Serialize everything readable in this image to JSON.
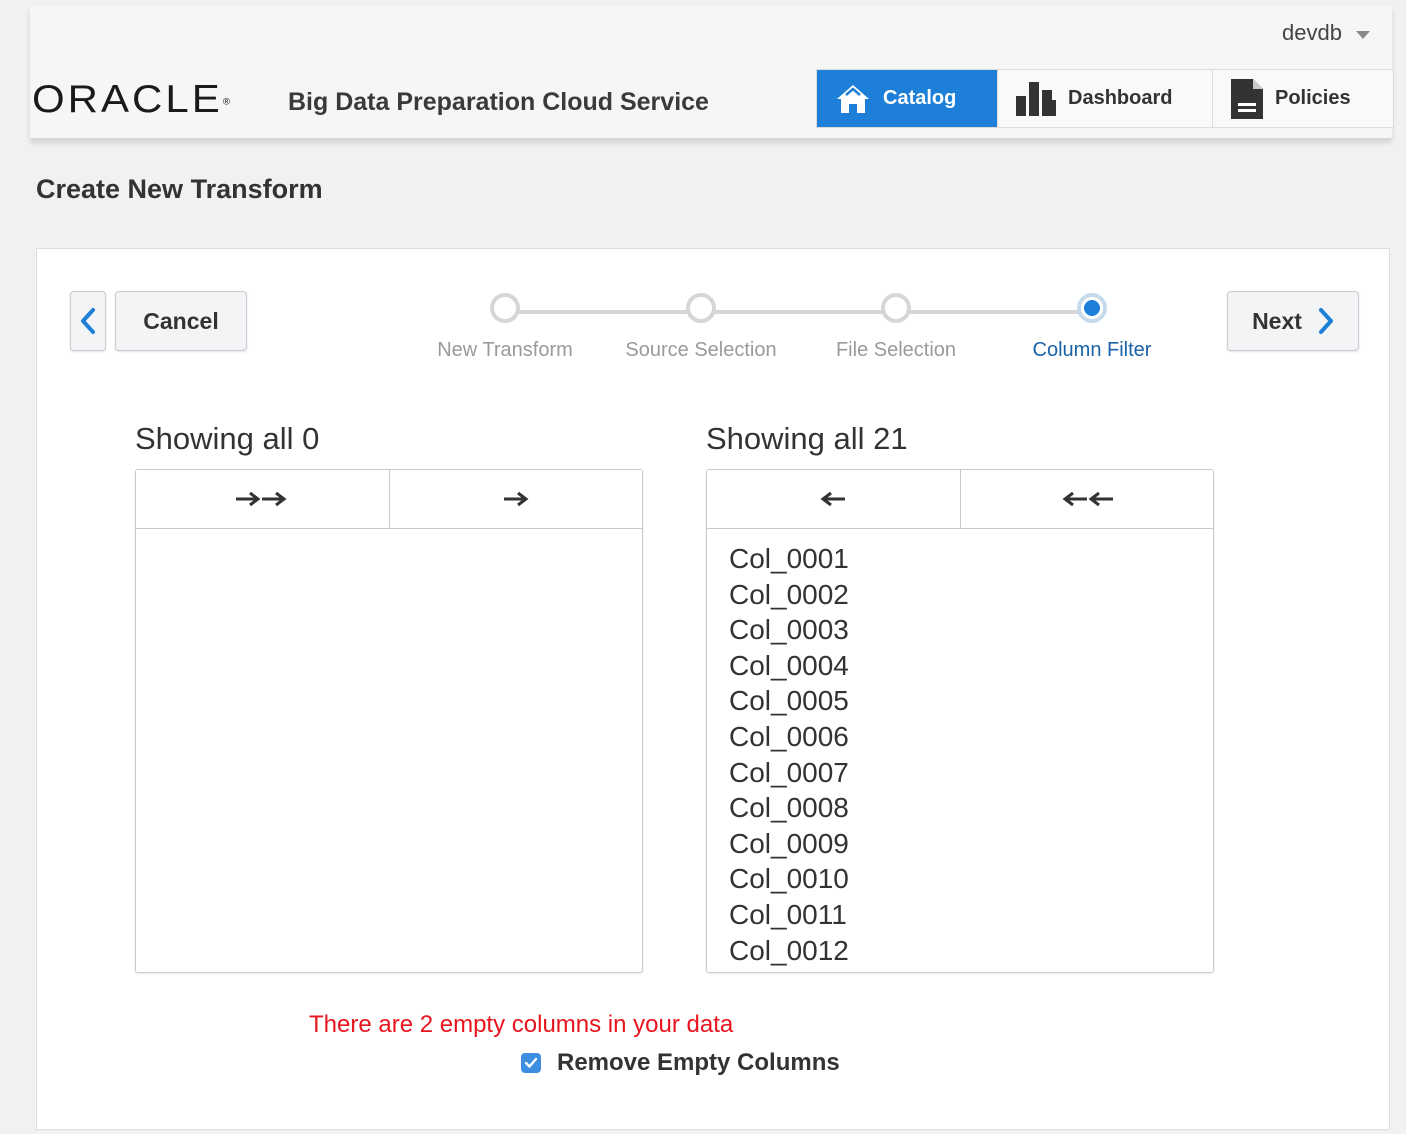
{
  "header": {
    "user": "devdb",
    "logo_text": "ORACLE",
    "service_name": "Big Data Preparation Cloud Service",
    "nav_tabs": [
      {
        "label": "Catalog",
        "icon": "home-icon",
        "active": true
      },
      {
        "label": "Dashboard",
        "icon": "bar-chart-icon",
        "active": false
      },
      {
        "label": "Policies",
        "icon": "document-icon",
        "active": false
      }
    ]
  },
  "page": {
    "title": "Create New Transform"
  },
  "wizard": {
    "back_icon": "chevron-left-icon",
    "cancel_label": "Cancel",
    "next_label": "Next",
    "next_icon": "chevron-right-icon",
    "steps": [
      {
        "label": "New Transform",
        "state": "done"
      },
      {
        "label": "Source Selection",
        "state": "done"
      },
      {
        "label": "File Selection",
        "state": "done"
      },
      {
        "label": "Column Filter",
        "state": "current"
      }
    ]
  },
  "shuttle": {
    "left": {
      "heading": "Showing all 0",
      "tools": [
        "move-all-right-icon",
        "move-right-icon"
      ],
      "items": []
    },
    "right": {
      "heading": "Showing all 21",
      "tools": [
        "move-left-icon",
        "move-all-left-icon"
      ],
      "items": [
        "Col_0001",
        "Col_0002",
        "Col_0003",
        "Col_0004",
        "Col_0005",
        "Col_0006",
        "Col_0007",
        "Col_0008",
        "Col_0009",
        "Col_0010",
        "Col_0011",
        "Col_0012"
      ]
    }
  },
  "empty_columns": {
    "warning": "There are 2 empty columns in your data",
    "checkbox_label": "Remove Empty Columns",
    "checked": true
  },
  "colors": {
    "accent": "#1e7fd8",
    "warning": "#e8141e",
    "current_step": "#1a62a8"
  }
}
